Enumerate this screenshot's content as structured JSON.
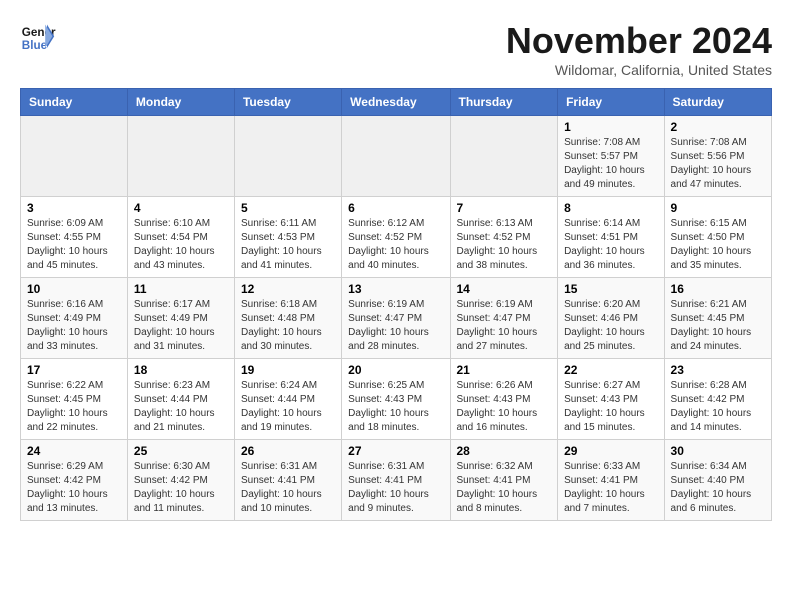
{
  "logo": {
    "line1": "General",
    "line2": "Blue"
  },
  "title": "November 2024",
  "subtitle": "Wildomar, California, United States",
  "weekdays": [
    "Sunday",
    "Monday",
    "Tuesday",
    "Wednesday",
    "Thursday",
    "Friday",
    "Saturday"
  ],
  "weeks": [
    [
      {
        "day": "",
        "info": ""
      },
      {
        "day": "",
        "info": ""
      },
      {
        "day": "",
        "info": ""
      },
      {
        "day": "",
        "info": ""
      },
      {
        "day": "",
        "info": ""
      },
      {
        "day": "1",
        "info": "Sunrise: 7:08 AM\nSunset: 5:57 PM\nDaylight: 10 hours\nand 49 minutes."
      },
      {
        "day": "2",
        "info": "Sunrise: 7:08 AM\nSunset: 5:56 PM\nDaylight: 10 hours\nand 47 minutes."
      }
    ],
    [
      {
        "day": "3",
        "info": "Sunrise: 6:09 AM\nSunset: 4:55 PM\nDaylight: 10 hours\nand 45 minutes."
      },
      {
        "day": "4",
        "info": "Sunrise: 6:10 AM\nSunset: 4:54 PM\nDaylight: 10 hours\nand 43 minutes."
      },
      {
        "day": "5",
        "info": "Sunrise: 6:11 AM\nSunset: 4:53 PM\nDaylight: 10 hours\nand 41 minutes."
      },
      {
        "day": "6",
        "info": "Sunrise: 6:12 AM\nSunset: 4:52 PM\nDaylight: 10 hours\nand 40 minutes."
      },
      {
        "day": "7",
        "info": "Sunrise: 6:13 AM\nSunset: 4:52 PM\nDaylight: 10 hours\nand 38 minutes."
      },
      {
        "day": "8",
        "info": "Sunrise: 6:14 AM\nSunset: 4:51 PM\nDaylight: 10 hours\nand 36 minutes."
      },
      {
        "day": "9",
        "info": "Sunrise: 6:15 AM\nSunset: 4:50 PM\nDaylight: 10 hours\nand 35 minutes."
      }
    ],
    [
      {
        "day": "10",
        "info": "Sunrise: 6:16 AM\nSunset: 4:49 PM\nDaylight: 10 hours\nand 33 minutes."
      },
      {
        "day": "11",
        "info": "Sunrise: 6:17 AM\nSunset: 4:49 PM\nDaylight: 10 hours\nand 31 minutes."
      },
      {
        "day": "12",
        "info": "Sunrise: 6:18 AM\nSunset: 4:48 PM\nDaylight: 10 hours\nand 30 minutes."
      },
      {
        "day": "13",
        "info": "Sunrise: 6:19 AM\nSunset: 4:47 PM\nDaylight: 10 hours\nand 28 minutes."
      },
      {
        "day": "14",
        "info": "Sunrise: 6:19 AM\nSunset: 4:47 PM\nDaylight: 10 hours\nand 27 minutes."
      },
      {
        "day": "15",
        "info": "Sunrise: 6:20 AM\nSunset: 4:46 PM\nDaylight: 10 hours\nand 25 minutes."
      },
      {
        "day": "16",
        "info": "Sunrise: 6:21 AM\nSunset: 4:45 PM\nDaylight: 10 hours\nand 24 minutes."
      }
    ],
    [
      {
        "day": "17",
        "info": "Sunrise: 6:22 AM\nSunset: 4:45 PM\nDaylight: 10 hours\nand 22 minutes."
      },
      {
        "day": "18",
        "info": "Sunrise: 6:23 AM\nSunset: 4:44 PM\nDaylight: 10 hours\nand 21 minutes."
      },
      {
        "day": "19",
        "info": "Sunrise: 6:24 AM\nSunset: 4:44 PM\nDaylight: 10 hours\nand 19 minutes."
      },
      {
        "day": "20",
        "info": "Sunrise: 6:25 AM\nSunset: 4:43 PM\nDaylight: 10 hours\nand 18 minutes."
      },
      {
        "day": "21",
        "info": "Sunrise: 6:26 AM\nSunset: 4:43 PM\nDaylight: 10 hours\nand 16 minutes."
      },
      {
        "day": "22",
        "info": "Sunrise: 6:27 AM\nSunset: 4:43 PM\nDaylight: 10 hours\nand 15 minutes."
      },
      {
        "day": "23",
        "info": "Sunrise: 6:28 AM\nSunset: 4:42 PM\nDaylight: 10 hours\nand 14 minutes."
      }
    ],
    [
      {
        "day": "24",
        "info": "Sunrise: 6:29 AM\nSunset: 4:42 PM\nDaylight: 10 hours\nand 13 minutes."
      },
      {
        "day": "25",
        "info": "Sunrise: 6:30 AM\nSunset: 4:42 PM\nDaylight: 10 hours\nand 11 minutes."
      },
      {
        "day": "26",
        "info": "Sunrise: 6:31 AM\nSunset: 4:41 PM\nDaylight: 10 hours\nand 10 minutes."
      },
      {
        "day": "27",
        "info": "Sunrise: 6:31 AM\nSunset: 4:41 PM\nDaylight: 10 hours\nand 9 minutes."
      },
      {
        "day": "28",
        "info": "Sunrise: 6:32 AM\nSunset: 4:41 PM\nDaylight: 10 hours\nand 8 minutes."
      },
      {
        "day": "29",
        "info": "Sunrise: 6:33 AM\nSunset: 4:41 PM\nDaylight: 10 hours\nand 7 minutes."
      },
      {
        "day": "30",
        "info": "Sunrise: 6:34 AM\nSunset: 4:40 PM\nDaylight: 10 hours\nand 6 minutes."
      }
    ]
  ],
  "colors": {
    "header_bg": "#4472c4",
    "header_text": "#ffffff",
    "empty_cell": "#f0f0f0"
  }
}
